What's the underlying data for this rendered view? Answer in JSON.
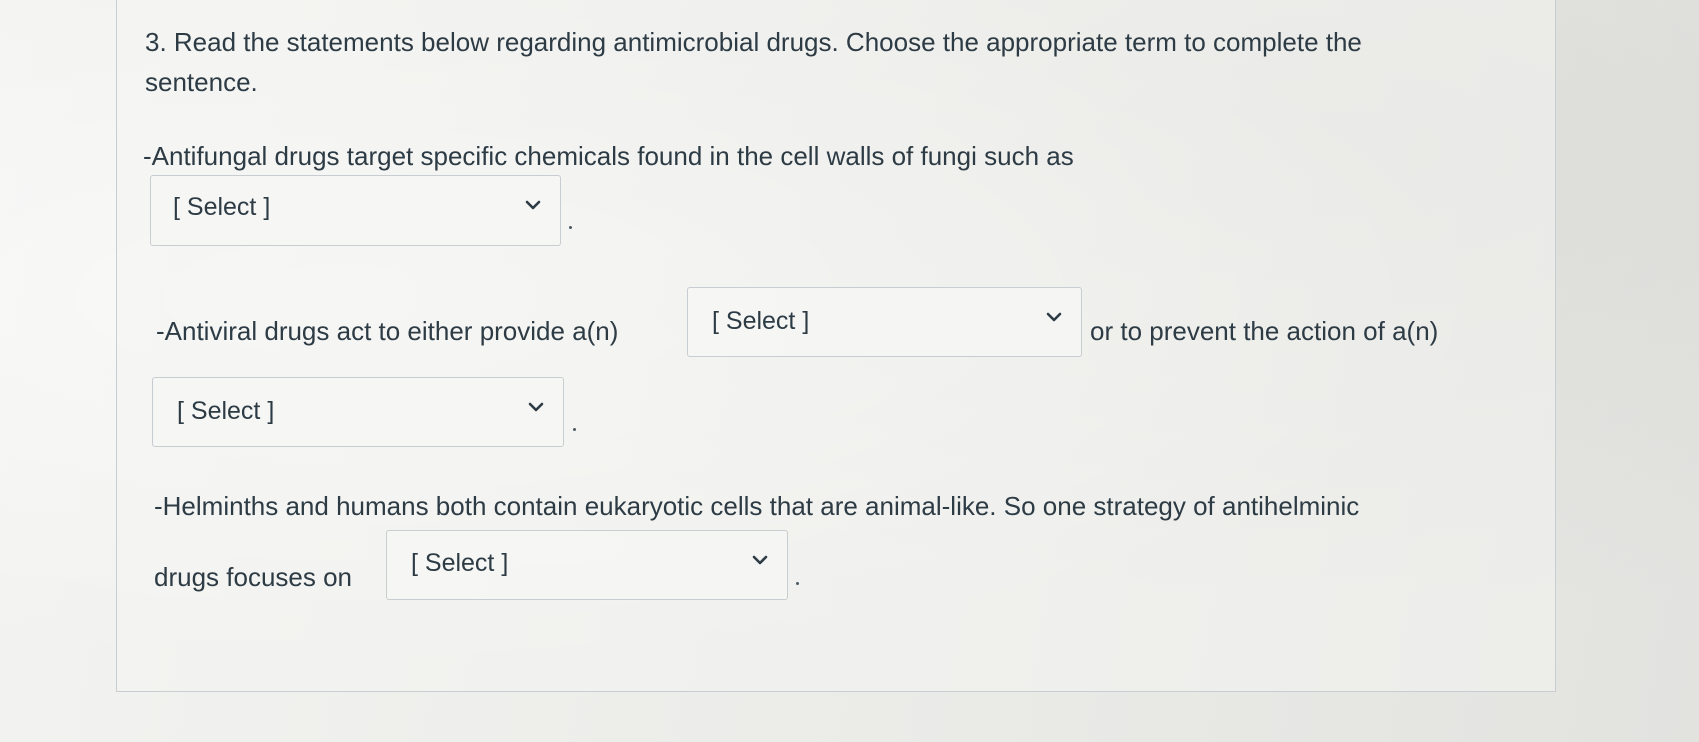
{
  "question": {
    "title_line1": "3. Read the statements below regarding antimicrobial drugs. Choose the appropriate term to complete the",
    "title_line2": "sentence."
  },
  "statements": {
    "antifungal_text": "-Antifungal drugs target specific chemicals found in the  cell walls of fungi such as",
    "antiviral_text_before": "-Antiviral drugs act to either provide a(n)",
    "antiviral_text_after": "or to prevent the action of a(n)",
    "helminth_text_line1": "-Helminths and humans both contain eukaryotic cells that are animal-like. So one strategy of antihelminic",
    "helminth_text_line2": "drugs focuses on"
  },
  "selects": {
    "antifungal": "[ Select ]",
    "antiviral_provide": "[ Select ]",
    "antiviral_prevent": "[ Select ]",
    "antihelminthic": "[ Select ]"
  },
  "icons": {
    "dropdown": "chevron-down-icon"
  },
  "colors": {
    "text": "#2d3b45",
    "border": "#c7cdd1"
  }
}
